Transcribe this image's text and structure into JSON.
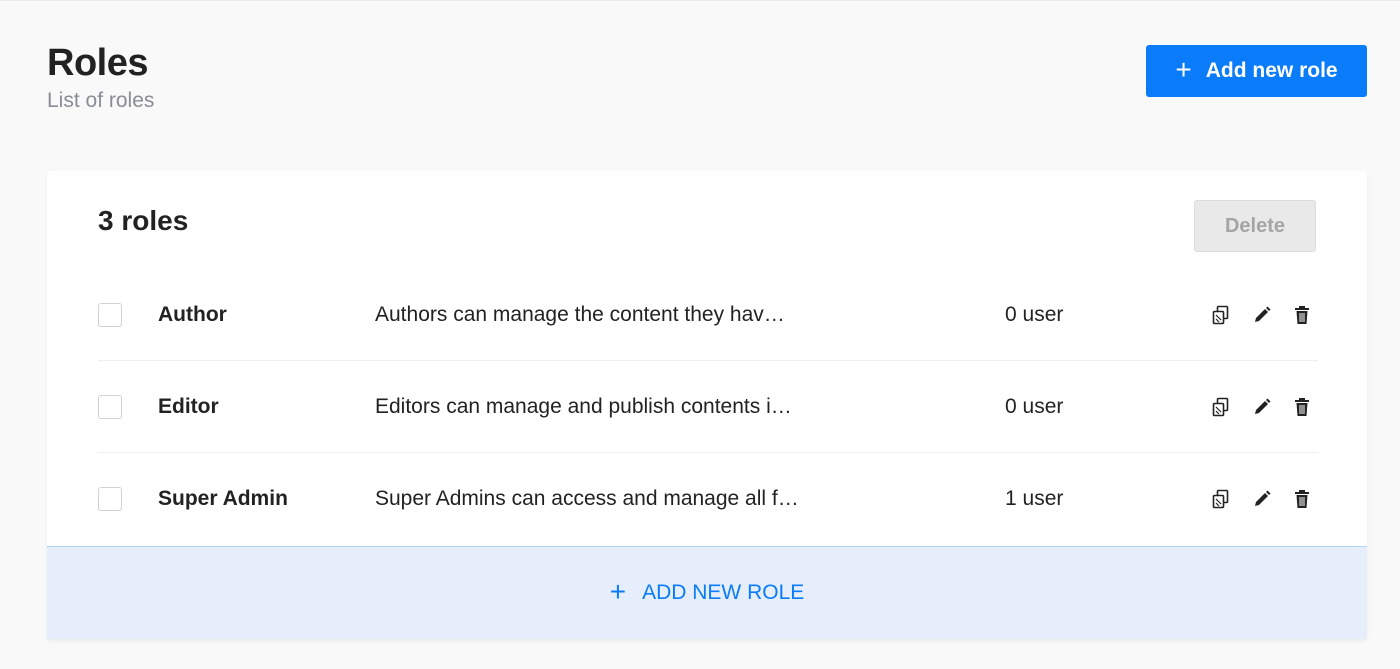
{
  "header": {
    "title": "Roles",
    "subtitle": "List of roles",
    "add_button_label": "Add new role",
    "add_button_icon": "plus-icon"
  },
  "card": {
    "title": "3 roles",
    "delete_label": "Delete"
  },
  "roles": [
    {
      "name": "Author",
      "description": "Authors can manage the content they hav…",
      "users": "0 user",
      "checked": false
    },
    {
      "name": "Editor",
      "description": "Editors can manage and publish contents i…",
      "users": "0 user",
      "checked": false
    },
    {
      "name": "Super Admin",
      "description": "Super Admins can access and manage all f…",
      "users": "1 user",
      "checked": false
    }
  ],
  "row_actions": [
    "duplicate-icon",
    "pencil-icon",
    "trash-icon"
  ],
  "footer": {
    "add_label": "ADD NEW ROLE"
  },
  "colors": {
    "accent": "#0a7cf9",
    "footer_bg": "#e5eefa",
    "delete_disabled_bg": "#e9e9e9"
  }
}
